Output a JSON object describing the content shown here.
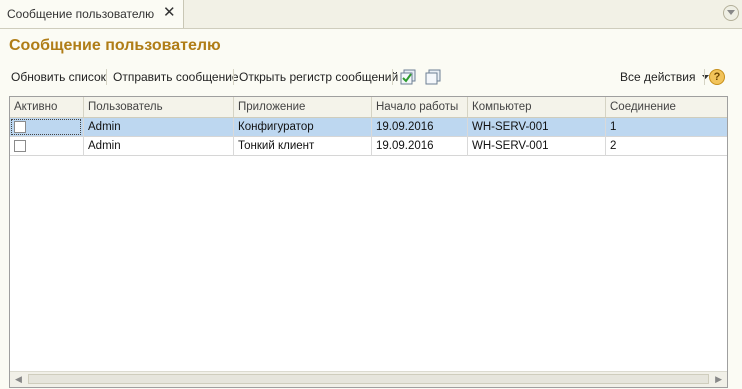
{
  "tab": {
    "label": "Сообщение пользователю",
    "close": "✕"
  },
  "title": "Сообщение пользователю",
  "toolbar": {
    "refresh": "Обновить список",
    "send": "Отправить сообщение",
    "open_register": "Открыть регистр сообщений",
    "all_actions": "Все действия",
    "help": "?"
  },
  "table": {
    "columns": [
      "Активно",
      "Пользователь",
      "Приложение",
      "Начало работы",
      "Компьютер",
      "Соединение"
    ],
    "rows": [
      {
        "active": false,
        "user": "Admin",
        "app": "Конфигуратор",
        "start": "19.09.2016",
        "computer": "WH-SERV-001",
        "conn": "1"
      },
      {
        "active": false,
        "user": "Admin",
        "app": "Тонкий клиент",
        "start": "19.09.2016",
        "computer": "WH-SERV-001",
        "conn": "2"
      }
    ]
  },
  "colors": {
    "title": "#b07d17",
    "selected_row": "#bdd7f0"
  }
}
